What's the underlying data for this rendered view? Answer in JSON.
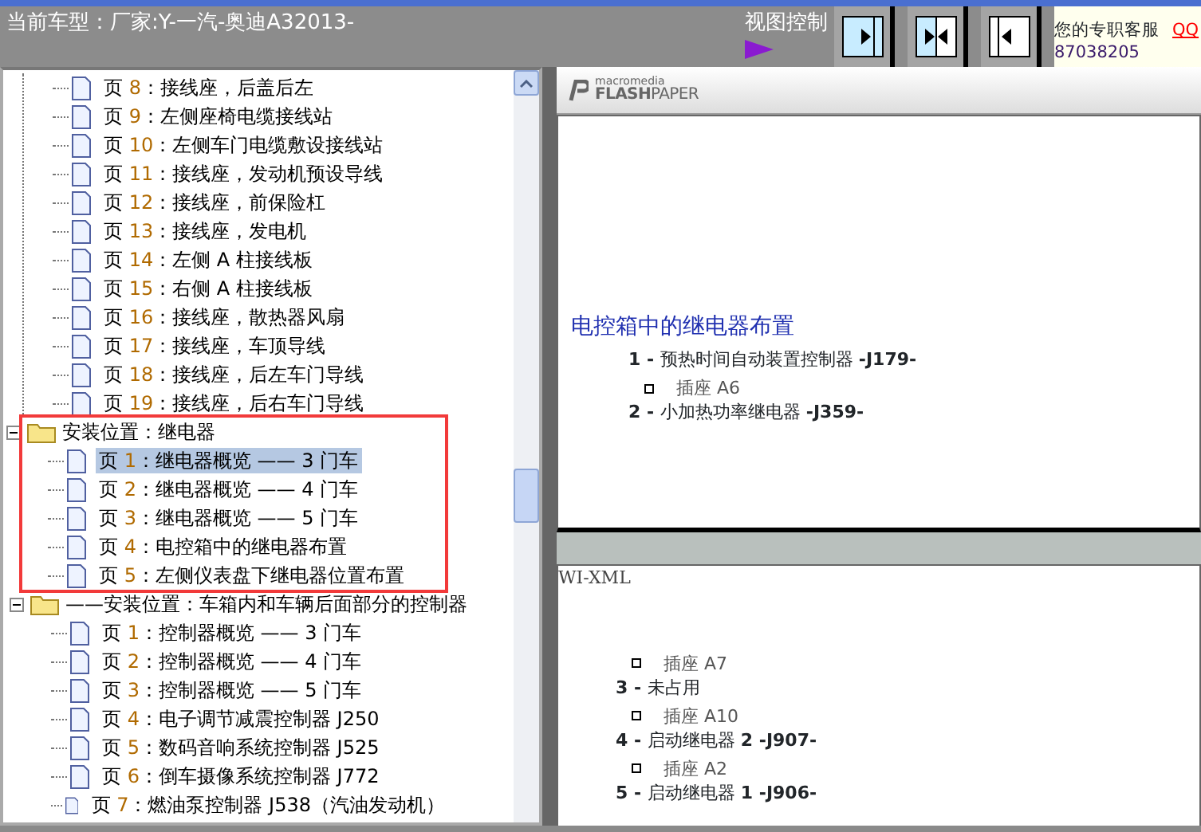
{
  "header": {
    "title": "当前车型：厂家:Y-一汽-奥迪A32013-",
    "view_control_label": "视图控制",
    "view_buttons": [
      {
        "kind": "expand-right"
      },
      {
        "kind": "split"
      },
      {
        "kind": "expand-left"
      }
    ],
    "service": {
      "label": "您的专职客服",
      "link": "QQ",
      "number": "87038205"
    }
  },
  "tree": {
    "orphan_pages": [
      {
        "prefix": "页",
        "number": "8",
        "title": "：接线座，后盖后左",
        "selected": false
      },
      {
        "prefix": "页",
        "number": "9",
        "title": "：左侧座椅电缆接线站",
        "selected": false
      },
      {
        "prefix": "页",
        "number": "10",
        "title": "：左侧车门电缆敷设接线站",
        "selected": false
      },
      {
        "prefix": "页",
        "number": "11",
        "title": "：接线座，发动机预设导线",
        "selected": false
      },
      {
        "prefix": "页",
        "number": "12",
        "title": "：接线座，前保险杠",
        "selected": false
      },
      {
        "prefix": "页",
        "number": "13",
        "title": "：接线座，发电机",
        "selected": false
      },
      {
        "prefix": "页",
        "number": "14",
        "title": "：左侧 A 柱接线板",
        "selected": false
      },
      {
        "prefix": "页",
        "number": "15",
        "title": "：右侧 A 柱接线板",
        "selected": false
      },
      {
        "prefix": "页",
        "number": "16",
        "title": "：接线座，散热器风扇",
        "selected": false
      },
      {
        "prefix": "页",
        "number": "17",
        "title": "：接线座，车顶导线",
        "selected": false
      },
      {
        "prefix": "页",
        "number": "18",
        "title": "：接线座，后左车门导线",
        "selected": false
      },
      {
        "prefix": "页",
        "number": "19",
        "title": "：接线座，后右车门导线",
        "selected": false
      }
    ],
    "groups": [
      {
        "title": "安装位置：继电器",
        "expanded": true,
        "highlighted": true,
        "children": [
          {
            "prefix": "页",
            "number": "1",
            "title": "：继电器概览 —— 3 门车",
            "selected": true
          },
          {
            "prefix": "页",
            "number": "2",
            "title": "：继电器概览 —— 4 门车",
            "selected": false
          },
          {
            "prefix": "页",
            "number": "3",
            "title": "：继电器概览 —— 5 门车",
            "selected": false
          },
          {
            "prefix": "页",
            "number": "4",
            "title": "：电控箱中的继电器布置",
            "selected": false
          },
          {
            "prefix": "页",
            "number": "5",
            "title": "：左侧仪表盘下继电器位置布置",
            "selected": false
          }
        ]
      },
      {
        "title": "——安装位置：车箱内和车辆后面部分的控制器",
        "expanded": true,
        "highlighted": false,
        "children": [
          {
            "prefix": "页",
            "number": "1",
            "title": "：控制器概览 —— 3 门车",
            "selected": false
          },
          {
            "prefix": "页",
            "number": "2",
            "title": "：控制器概览 —— 4 门车",
            "selected": false
          },
          {
            "prefix": "页",
            "number": "3",
            "title": "：控制器概览 —— 5 门车",
            "selected": false
          },
          {
            "prefix": "页",
            "number": "4",
            "title": "：电子调节减震控制器 J250",
            "selected": false
          },
          {
            "prefix": "页",
            "number": "5",
            "title": "：数码音响系统控制器 J525",
            "selected": false
          },
          {
            "prefix": "页",
            "number": "6",
            "title": "：倒车摄像系统控制器 J772",
            "selected": false
          },
          {
            "prefix": "页",
            "number": "7",
            "title": "：燃油泵控制器 J538（汽油发动机）",
            "selected": false
          }
        ]
      }
    ]
  },
  "viewer": {
    "logo": {
      "top": "macromedia",
      "bold": "FLASH",
      "light": "PAPER"
    },
    "pages": [
      {
        "lines": [
          {
            "kind": "heading",
            "text": "电控箱中的继电器布置"
          },
          {
            "kind": "item",
            "number": "1 -",
            "text": "预热时间自动装置控制器 **-J179-**"
          },
          {
            "kind": "socket",
            "text": "插座 A6"
          },
          {
            "kind": "item",
            "number": "2 -",
            "text": "小加热功率继电器 **-J359-**"
          }
        ]
      },
      {
        "label": "WI-XML",
        "lines": [
          {
            "kind": "socket",
            "text": "插座 A7"
          },
          {
            "kind": "item",
            "number": "3 -",
            "text": "未占用"
          },
          {
            "kind": "socket",
            "text": "插座 A10"
          },
          {
            "kind": "item",
            "number": "4 -",
            "text": "启动继电器 **2 -J907-**"
          },
          {
            "kind": "socket",
            "text": "插座 A2"
          },
          {
            "kind": "item",
            "number": "5 -",
            "text": "启动继电器 **1 -J906-**"
          }
        ]
      }
    ]
  }
}
